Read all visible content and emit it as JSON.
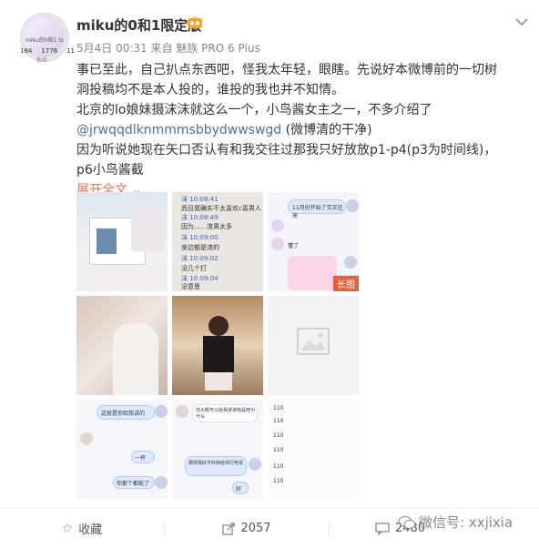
{
  "user": {
    "name": "miku的0和1限定版",
    "avatar_caption": "miku的0和1 ts",
    "stats": [
      "184",
      "1776",
      "11"
    ],
    "stats_sub": "粉丝"
  },
  "post": {
    "date": "5月4日",
    "time": "00:31",
    "source": "来自 魅族 PRO 6 Plus",
    "lines": [
      "事已至此，自己扒点东西吧，怪我太年轻，眼瞎。先说好本微博前的一切树洞投稿均不是本人投的，谁投的我也并不知情。",
      "北京的lo娘妹摄沫沫就这么一个，小鸟酱女主之一，不多介绍了",
      "因为听说她现在矢口否认有和我交往过那我只好放放p1-p4(p3为时间线)，p6小鸟酱截"
    ],
    "mention": "@jrwqqdlknmmmsbbydwwswgd",
    "mention_suffix": "(微博清的干净)",
    "expand": "展开全文"
  },
  "images": {
    "long_tag": "长图",
    "chat_p2": [
      "沫 10:08:41",
      "而且我确实不太喜欢c喜男人",
      "沫 10:08:49",
      "因为……渣男太多",
      "沫 10:09:00",
      "身边都是渣的",
      "沫 10:09:02",
      "没几个打",
      "沫 10:09:04",
      "没意思"
    ],
    "chat_p3": [
      "11月份开始了交叉往来",
      "懂了"
    ],
    "chat_p7": [
      "这就是你给我讲的",
      "一杯",
      "你那个都能了"
    ],
    "chat_p8": [
      "你大概可以给我讲讲她是吧为什么",
      "那样我好不好转给你行吧说",
      "好"
    ],
    "chat_p9": [
      "110",
      "110",
      "110",
      "110",
      "110",
      "110"
    ]
  },
  "footer": {
    "collect": "收藏",
    "repost": "2057",
    "comment": "2480"
  },
  "watermark": "微信号: xxjixia"
}
